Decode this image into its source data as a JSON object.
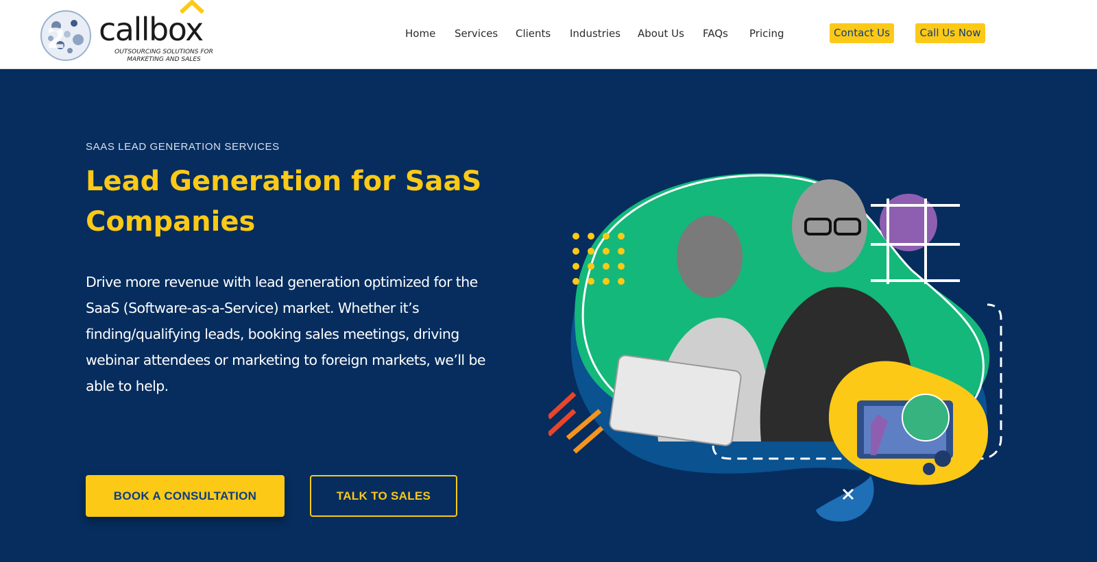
{
  "brand": {
    "name": "callbox",
    "tagline_line1": "OUTSOURCING SOLUTIONS FOR",
    "tagline_line2": "MARKETING AND SALES"
  },
  "nav": {
    "items": [
      {
        "label": "Home"
      },
      {
        "label": "Services"
      },
      {
        "label": "Clients"
      },
      {
        "label": "Industries"
      },
      {
        "label": "About Us"
      },
      {
        "label": "FAQs"
      },
      {
        "label": "Pricing"
      }
    ],
    "contact_label": "Contact Us",
    "call_label": "Call Us Now"
  },
  "hero": {
    "eyebrow": "SAAS LEAD GENERATION SERVICES",
    "title_line1": "Lead Generation for SaaS",
    "title_line2": "Companies",
    "description_lines": [
      "Drive more revenue with lead generation optimized for the",
      "SaaS (Software-as-a-Service) market. Whether it’s",
      "finding/qualifying leads, booking sales meetings, driving",
      "webinar attendees or marketing to foreign markets, we’ll be",
      "able to help."
    ],
    "primary_cta": "BOOK A CONSULTATION",
    "secondary_cta": "TALK TO SALES"
  },
  "colors": {
    "accent": "#fcc917",
    "background": "#062d5e",
    "link": "#0b3d83",
    "blob_green": "#14b87a",
    "blob_blue": "#0a5290",
    "blob_purple": "#8e5fb0"
  }
}
